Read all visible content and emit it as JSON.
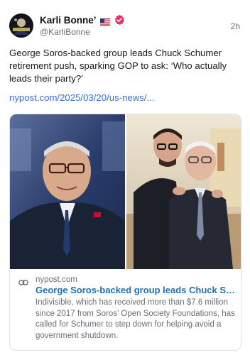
{
  "author": {
    "display_name": "Karli Bonne’",
    "flag": "US",
    "handle": "@KarliBonne",
    "time": "2h",
    "avatar_icon": "avatar-icon",
    "verified_color": "#e1306c"
  },
  "post": {
    "text": "George Soros-backed group leads Chuck Schumer retirement push, sparking GOP to ask: ‘Who actually leads their party?’",
    "link": "nypost.com/2025/03/20/us-news/..."
  },
  "card": {
    "domain": "nypost.com",
    "title": "George Soros-backed group leads Chuck Sch...",
    "description": "Indivisible, which has received more than $7.6 million since 2017 from Soros’ Open Society Foundations, has called for Schumer to step down for helping avoid a government shutdown.",
    "link_icon": "link-icon"
  },
  "colors": {
    "link": "#3b6fd6",
    "card_title": "#1f6fb4",
    "muted": "#6b6f76"
  }
}
